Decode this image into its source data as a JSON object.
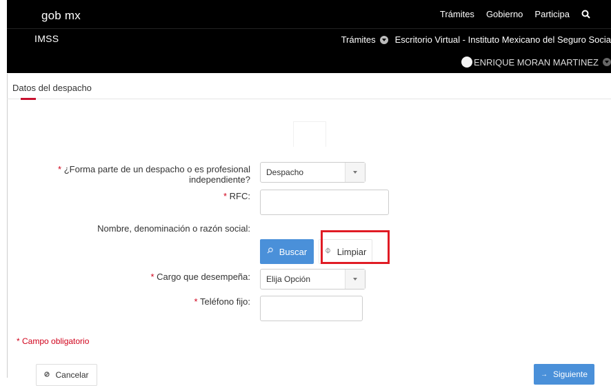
{
  "header": {
    "logo": "gob mx",
    "nav": [
      "Trámites",
      "Gobierno",
      "Participa"
    ],
    "search_icon": "search-icon"
  },
  "subheader": {
    "title": "IMSS",
    "tramites": "Trámites",
    "breadcrumb": "Escritorio Virtual - Instituto Mexicano del Seguro Socia",
    "user": "ENRIQUE MORAN MARTINEZ"
  },
  "page": {
    "section_title": "Datos del despacho"
  },
  "form": {
    "q_despacho_label": "¿Forma parte de un despacho o es profesional independiente?",
    "q_despacho_value": "Despacho",
    "rfc_label": "RFC:",
    "rfc_value": "",
    "nombre_label": "Nombre, denominación o razón social:",
    "buscar_label": "Buscar",
    "limpiar_label": "Limpiar",
    "cargo_label": "Cargo que desempeña:",
    "cargo_value": "Elija Opción",
    "telefono_label": "Teléfono fijo:",
    "telefono_value": "",
    "required_mark": "*",
    "required_note": "* Campo obligatorio"
  },
  "actions": {
    "cancel_label": "Cancelar",
    "next_label": "Siguiente"
  },
  "colors": {
    "accent_blue": "#4a90d9",
    "required_red": "#d0021b",
    "highlight_red": "#e01b24"
  }
}
